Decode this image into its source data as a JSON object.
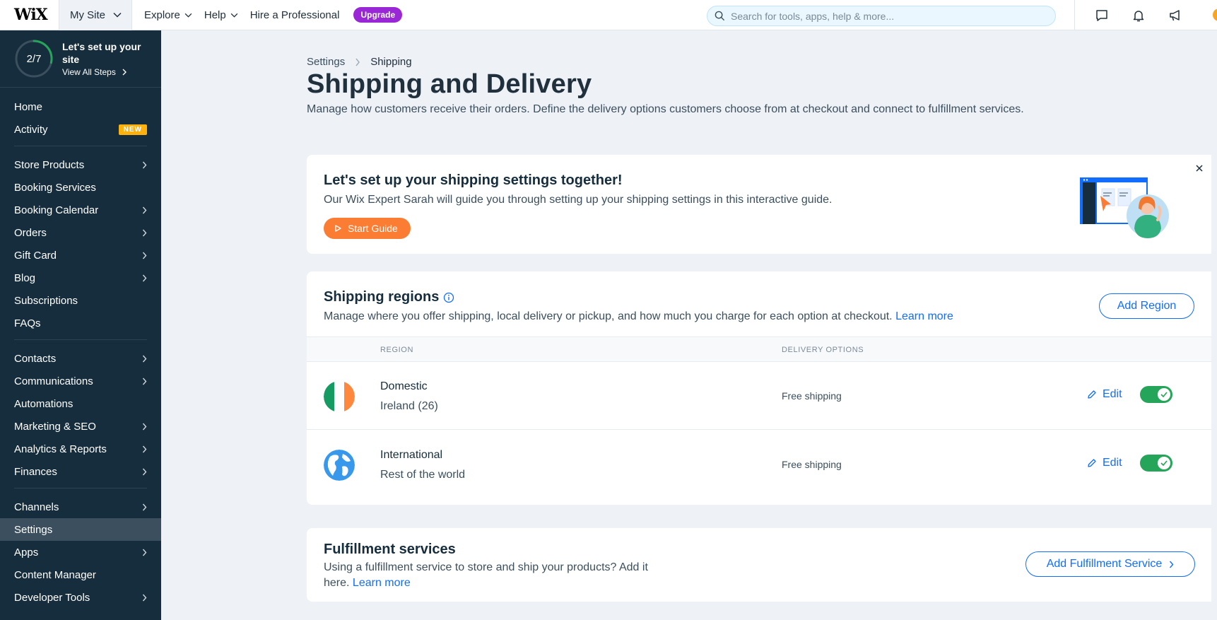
{
  "topbar": {
    "logo": "WiX",
    "site_selector": "My Site",
    "nav": [
      "Explore",
      "Help",
      "Hire a Professional"
    ],
    "upgrade": "Upgrade",
    "search_placeholder": "Search for tools, apps, help & more..."
  },
  "sidebar": {
    "setup": {
      "progress": "2/7",
      "progress_fraction": 0.2857,
      "title": "Let's set up your site",
      "link": "View All Steps"
    },
    "groups": [
      [
        {
          "label": "Home"
        },
        {
          "label": "Activity",
          "badge": "NEW"
        }
      ],
      [
        {
          "label": "Store Products",
          "arrow": true
        },
        {
          "label": "Booking Services"
        },
        {
          "label": "Booking Calendar",
          "arrow": true
        },
        {
          "label": "Orders",
          "arrow": true
        },
        {
          "label": "Gift Card",
          "arrow": true
        },
        {
          "label": "Blog",
          "arrow": true
        },
        {
          "label": "Subscriptions"
        },
        {
          "label": "FAQs"
        }
      ],
      [
        {
          "label": "Contacts",
          "arrow": true
        },
        {
          "label": "Communications",
          "arrow": true
        },
        {
          "label": "Automations"
        },
        {
          "label": "Marketing & SEO",
          "arrow": true
        },
        {
          "label": "Analytics & Reports",
          "arrow": true
        },
        {
          "label": "Finances",
          "arrow": true
        }
      ],
      [
        {
          "label": "Channels",
          "arrow": true
        },
        {
          "label": "Settings",
          "active": true
        },
        {
          "label": "Apps",
          "arrow": true
        },
        {
          "label": "Content Manager"
        },
        {
          "label": "Developer Tools",
          "arrow": true
        }
      ]
    ]
  },
  "breadcrumb": {
    "parent": "Settings",
    "current": "Shipping"
  },
  "page": {
    "title": "Shipping and Delivery",
    "description": "Manage how customers receive their orders. Define the delivery options customers choose from at checkout and connect to fulfillment services."
  },
  "guide": {
    "title": "Let's set up your shipping settings together!",
    "description": "Our Wix Expert Sarah will guide you through setting up your shipping settings in this interactive guide.",
    "button": "Start Guide"
  },
  "regions": {
    "title": "Shipping regions",
    "description": "Manage where you offer shipping, local delivery or pickup, and how much you charge for each option at checkout.",
    "learn_more": "Learn more",
    "add_button": "Add Region",
    "columns": [
      "REGION",
      "DELIVERY OPTIONS"
    ],
    "rows": [
      {
        "name": "Domestic",
        "sub": "Ireland (26)",
        "option": "Free shipping",
        "edit": "Edit",
        "enabled": true
      },
      {
        "name": "International",
        "sub": "Rest of the world",
        "option": "Free shipping",
        "edit": "Edit",
        "enabled": true
      }
    ]
  },
  "fulfillment": {
    "title": "Fulfillment services",
    "description": "Using a fulfillment service to store and ship your products? Add it here.",
    "learn_more": "Learn more",
    "add_button": "Add Fulfillment Service"
  },
  "colors": {
    "sidebar_bg": "#162d3d",
    "accent_blue": "#116dff",
    "upgrade_purple": "#9a27d5",
    "guide_orange": "#fb7d33",
    "toggle_green": "#25a55a",
    "new_badge": "#fdb10c"
  }
}
